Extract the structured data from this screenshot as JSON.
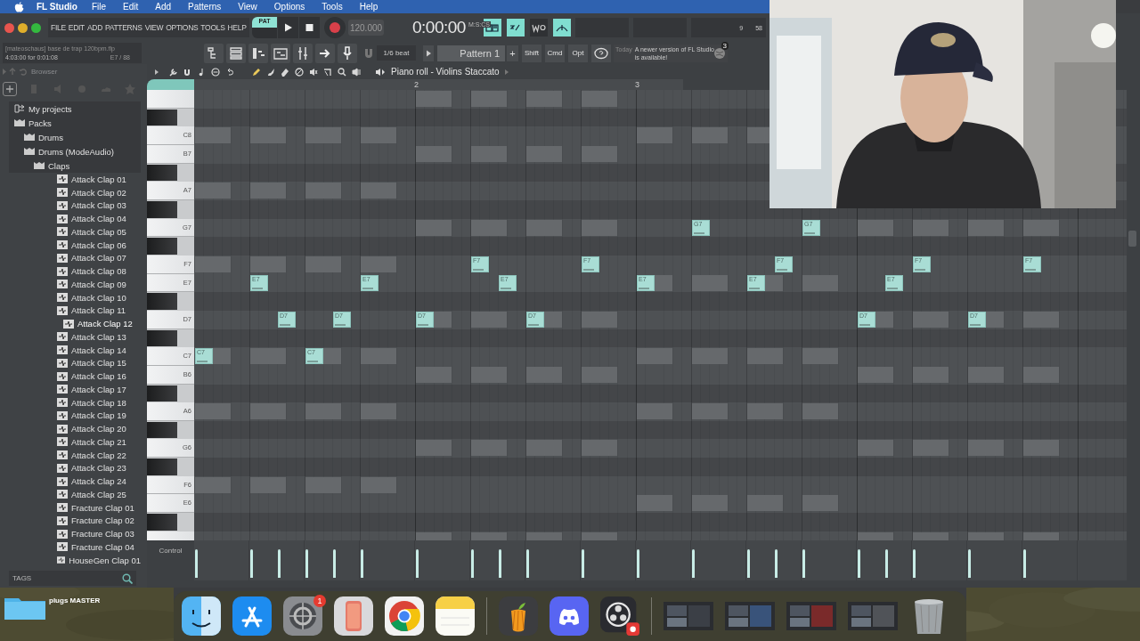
{
  "menubar": {
    "app": "FL Studio",
    "items": [
      "File",
      "Edit",
      "Add",
      "Patterns",
      "View",
      "Options",
      "Tools",
      "Help"
    ]
  },
  "toolbar": {
    "menu": [
      "FILE",
      "EDIT",
      "ADD",
      "PATTERNS",
      "VIEW",
      "OPTIONS",
      "TOOLS",
      "HELP"
    ],
    "pat_label": "PAT",
    "pattern_mode": true,
    "tempo": "120.000",
    "time": "0:00:00",
    "time_unit": "M:S:CS",
    "toggles": [
      {
        "on": true
      },
      {
        "on": true
      },
      {
        "on": false
      },
      {
        "on": true
      }
    ],
    "cpu": "9",
    "memory": "58"
  },
  "project": {
    "title": "[mateoschaus] base de trap 120bpm.flp",
    "time": "4:03:00 for 0:01:08",
    "note": "E7 / 88"
  },
  "snap": "1/6 beat",
  "pattern": "Pattern 1",
  "pattern_add": "+",
  "modifiers": [
    "Shift",
    "Cmd",
    "Opt"
  ],
  "hint": {
    "day": "Today",
    "text": "A newer version of FL Studio is available!",
    "badge": "3"
  },
  "browser": {
    "title": "Browser",
    "tags_label": "TAGS",
    "tree": [
      {
        "label": "My projects",
        "kind": "projects",
        "selected": false
      },
      {
        "label": "Packs",
        "kind": "folder",
        "selected": false,
        "children": [
          {
            "label": "Drums",
            "kind": "folder",
            "selected": false
          },
          {
            "label": "Drums (ModeAudio)",
            "kind": "folder",
            "selected": false,
            "children": [
              {
                "label": "Claps",
                "kind": "folder",
                "selected": false,
                "children": [
                  {
                    "label": "Attack Clap 01",
                    "kind": "sample",
                    "selected": false
                  },
                  {
                    "label": "Attack Clap 02",
                    "kind": "sample",
                    "selected": false
                  },
                  {
                    "label": "Attack Clap 03",
                    "kind": "sample",
                    "selected": false
                  },
                  {
                    "label": "Attack Clap 04",
                    "kind": "sample",
                    "selected": false
                  },
                  {
                    "label": "Attack Clap 05",
                    "kind": "sample",
                    "selected": false
                  },
                  {
                    "label": "Attack Clap 06",
                    "kind": "sample",
                    "selected": false
                  },
                  {
                    "label": "Attack Clap 07",
                    "kind": "sample",
                    "selected": false
                  },
                  {
                    "label": "Attack Clap 08",
                    "kind": "sample",
                    "selected": false
                  },
                  {
                    "label": "Attack Clap 09",
                    "kind": "sample",
                    "selected": false
                  },
                  {
                    "label": "Attack Clap 10",
                    "kind": "sample",
                    "selected": false
                  },
                  {
                    "label": "Attack Clap 11",
                    "kind": "sample",
                    "selected": false
                  },
                  {
                    "label": "Attack Clap 12",
                    "kind": "sample",
                    "selected": true
                  },
                  {
                    "label": "Attack Clap 13",
                    "kind": "sample",
                    "selected": false
                  },
                  {
                    "label": "Attack Clap 14",
                    "kind": "sample",
                    "selected": false
                  },
                  {
                    "label": "Attack Clap 15",
                    "kind": "sample",
                    "selected": false
                  },
                  {
                    "label": "Attack Clap 16",
                    "kind": "sample",
                    "selected": false
                  },
                  {
                    "label": "Attack Clap 17",
                    "kind": "sample",
                    "selected": false
                  },
                  {
                    "label": "Attack Clap 18",
                    "kind": "sample",
                    "selected": false
                  },
                  {
                    "label": "Attack Clap 19",
                    "kind": "sample",
                    "selected": false
                  },
                  {
                    "label": "Attack Clap 20",
                    "kind": "sample",
                    "selected": false
                  },
                  {
                    "label": "Attack Clap 21",
                    "kind": "sample",
                    "selected": false
                  },
                  {
                    "label": "Attack Clap 22",
                    "kind": "sample",
                    "selected": false
                  },
                  {
                    "label": "Attack Clap 23",
                    "kind": "sample",
                    "selected": false
                  },
                  {
                    "label": "Attack Clap 24",
                    "kind": "sample",
                    "selected": false
                  },
                  {
                    "label": "Attack Clap 25",
                    "kind": "sample",
                    "selected": false
                  },
                  {
                    "label": "Fracture Clap 01",
                    "kind": "sample",
                    "selected": false
                  },
                  {
                    "label": "Fracture Clap 02",
                    "kind": "sample",
                    "selected": false
                  },
                  {
                    "label": "Fracture Clap 03",
                    "kind": "sample",
                    "selected": false
                  },
                  {
                    "label": "Fracture Clap 04",
                    "kind": "sample",
                    "selected": false
                  },
                  {
                    "label": "HouseGen Clap 01",
                    "kind": "sample",
                    "selected": false
                  }
                ]
              }
            ]
          }
        ]
      }
    ]
  },
  "piano_roll": {
    "title": "Piano roll - Violins Staccato",
    "control_label": "Control",
    "tools": [
      {
        "kind": "pencil",
        "selected": true
      },
      {
        "kind": "brush",
        "selected": false
      },
      {
        "kind": "delete",
        "selected": false
      },
      {
        "kind": "mute",
        "selected": false
      },
      {
        "kind": "slice",
        "selected": false
      },
      {
        "kind": "select",
        "selected": false
      },
      {
        "kind": "zoom",
        "selected": false
      },
      {
        "kind": "playback",
        "selected": false
      }
    ],
    "bars": [
      {
        "label": "2"
      },
      {
        "label": "3"
      }
    ],
    "rows": [
      {
        "kind": "white",
        "beats": [
          {
            "kind": "rest"
          },
          {
            "kind": "rest"
          },
          {
            "kind": "rest"
          },
          {
            "kind": "rest"
          },
          {
            "kind": "ghost"
          },
          {
            "kind": "ghost"
          },
          {
            "kind": "ghost"
          },
          {
            "kind": "ghost"
          }
        ]
      },
      {
        "kind": "black"
      },
      {
        "kind": "white",
        "label": "C8",
        "beats": [
          {
            "kind": "ghost"
          },
          {
            "kind": "ghost"
          },
          {
            "kind": "ghost"
          },
          {
            "kind": "ghost"
          },
          {
            "kind": "rest"
          },
          {
            "kind": "rest"
          },
          {
            "kind": "rest"
          },
          {
            "kind": "rest"
          },
          {
            "kind": "ghost"
          },
          {
            "kind": "ghost"
          },
          {
            "kind": "ghost"
          }
        ]
      },
      {
        "kind": "white",
        "label": "B7",
        "beats": [
          {
            "kind": "rest"
          },
          {
            "kind": "rest"
          },
          {
            "kind": "rest"
          },
          {
            "kind": "rest"
          },
          {
            "kind": "ghost"
          },
          {
            "kind": "ghost"
          },
          {
            "kind": "ghost"
          },
          {
            "kind": "ghost"
          }
        ]
      },
      {
        "kind": "black"
      },
      {
        "kind": "white",
        "label": "A7",
        "beats": [
          {
            "kind": "ghost"
          },
          {
            "kind": "ghost"
          },
          {
            "kind": "ghost"
          },
          {
            "kind": "ghost"
          }
        ]
      },
      {
        "kind": "black"
      },
      {
        "kind": "white",
        "label": "G7",
        "beats": [
          {
            "kind": "rest"
          },
          {
            "kind": "rest"
          },
          {
            "kind": "rest"
          },
          {
            "kind": "rest"
          },
          {
            "kind": "ghost"
          },
          {
            "kind": "ghost"
          },
          {
            "kind": "ghost"
          },
          {
            "kind": "ghost"
          },
          {
            "kind": "rest"
          },
          {
            "kind": "rest",
            "note": {
              "label": "G7"
            }
          },
          {
            "kind": "rest"
          },
          {
            "kind": "rest",
            "note": {
              "label": "G7"
            }
          },
          {
            "kind": "ghost"
          },
          {
            "kind": "ghost"
          },
          {
            "kind": "ghost"
          },
          {
            "kind": "ghost"
          }
        ]
      },
      {
        "kind": "black"
      },
      {
        "kind": "white",
        "label": "F7",
        "beats": [
          {
            "kind": "ghost"
          },
          {
            "kind": "ghost"
          },
          {
            "kind": "ghost"
          },
          {
            "kind": "ghost"
          },
          {
            "kind": "rest"
          },
          {
            "kind": "rest",
            "note": {
              "label": "F7"
            }
          },
          {
            "kind": "rest"
          },
          {
            "kind": "rest",
            "note": {
              "label": "F7"
            }
          },
          {
            "kind": "rest"
          },
          {
            "kind": "rest"
          },
          {
            "kind": "rest",
            "note_mid": {
              "label": "F7"
            }
          },
          {
            "kind": "rest"
          },
          {
            "kind": "rest"
          },
          {
            "kind": "rest",
            "note": {
              "label": "F7"
            }
          },
          {
            "kind": "rest"
          },
          {
            "kind": "rest",
            "note": {
              "label": "F7"
            }
          }
        ]
      },
      {
        "kind": "white",
        "label": "E7",
        "beats": [
          {
            "kind": "rest"
          },
          {
            "kind": "rest",
            "note": {
              "label": "E7"
            }
          },
          {
            "kind": "rest"
          },
          {
            "kind": "rest",
            "note": {
              "label": "E7"
            }
          },
          {
            "kind": "rest"
          },
          {
            "kind": "rest",
            "note_mid": {
              "label": "E7"
            }
          },
          {
            "kind": "rest"
          },
          {
            "kind": "rest"
          },
          {
            "kind": "ghost",
            "note": {
              "label": "E7"
            }
          },
          {
            "kind": "ghost"
          },
          {
            "kind": "ghost",
            "note": {
              "label": "E7"
            }
          },
          {
            "kind": "ghost"
          },
          {
            "kind": "rest",
            "note_mid": {
              "label": "E7"
            }
          }
        ]
      },
      {
        "kind": "black"
      },
      {
        "kind": "white",
        "label": "D7",
        "beats": [
          {
            "kind": "rest"
          },
          {
            "kind": "rest",
            "note_mid": {
              "label": "D7"
            }
          },
          {
            "kind": "rest",
            "note_mid": {
              "label": "D7"
            }
          },
          {
            "kind": "rest"
          },
          {
            "kind": "ghost",
            "note": {
              "label": "D7"
            }
          },
          {
            "kind": "ghost"
          },
          {
            "kind": "ghost",
            "note": {
              "label": "D7"
            }
          },
          {
            "kind": "ghost"
          },
          {
            "kind": "rest"
          },
          {
            "kind": "rest"
          },
          {
            "kind": "rest"
          },
          {
            "kind": "rest"
          },
          {
            "kind": "ghost",
            "note": {
              "label": "D7"
            }
          },
          {
            "kind": "ghost"
          },
          {
            "kind": "ghost",
            "note": {
              "label": "D7"
            }
          },
          {
            "kind": "ghost"
          }
        ]
      },
      {
        "kind": "black"
      },
      {
        "kind": "white",
        "label": "C7",
        "beats": [
          {
            "kind": "ghost",
            "note": {
              "label": "C7"
            }
          },
          {
            "kind": "ghost"
          },
          {
            "kind": "ghost",
            "note": {
              "label": "C7"
            }
          },
          {
            "kind": "ghost"
          },
          {
            "kind": "rest"
          },
          {
            "kind": "rest"
          },
          {
            "kind": "rest"
          },
          {
            "kind": "rest"
          },
          {
            "kind": "ghost"
          },
          {
            "kind": "ghost"
          },
          {
            "kind": "ghost"
          },
          {
            "kind": "ghost"
          }
        ]
      },
      {
        "kind": "white",
        "label": "B6",
        "beats": [
          {
            "kind": "rest"
          },
          {
            "kind": "rest"
          },
          {
            "kind": "rest"
          },
          {
            "kind": "rest"
          },
          {
            "kind": "ghost"
          },
          {
            "kind": "ghost"
          },
          {
            "kind": "ghost"
          },
          {
            "kind": "ghost"
          },
          {
            "kind": "rest"
          },
          {
            "kind": "rest"
          },
          {
            "kind": "rest"
          },
          {
            "kind": "rest"
          },
          {
            "kind": "ghost"
          },
          {
            "kind": "ghost"
          },
          {
            "kind": "ghost"
          },
          {
            "kind": "ghost"
          }
        ]
      },
      {
        "kind": "black"
      },
      {
        "kind": "white",
        "label": "A6",
        "beats": [
          {
            "kind": "ghost"
          },
          {
            "kind": "ghost"
          },
          {
            "kind": "ghost"
          },
          {
            "kind": "ghost"
          },
          {
            "kind": "rest"
          },
          {
            "kind": "rest"
          },
          {
            "kind": "rest"
          },
          {
            "kind": "rest"
          },
          {
            "kind": "ghost"
          },
          {
            "kind": "ghost"
          },
          {
            "kind": "ghost"
          },
          {
            "kind": "ghost"
          }
        ]
      },
      {
        "kind": "black"
      },
      {
        "kind": "white",
        "label": "G6",
        "beats": [
          {
            "kind": "rest"
          },
          {
            "kind": "rest"
          },
          {
            "kind": "rest"
          },
          {
            "kind": "rest"
          },
          {
            "kind": "ghost"
          },
          {
            "kind": "ghost"
          },
          {
            "kind": "ghost"
          },
          {
            "kind": "ghost"
          },
          {
            "kind": "rest"
          },
          {
            "kind": "rest"
          },
          {
            "kind": "rest"
          },
          {
            "kind": "rest"
          },
          {
            "kind": "ghost"
          },
          {
            "kind": "ghost"
          },
          {
            "kind": "ghost"
          },
          {
            "kind": "ghost"
          }
        ]
      },
      {
        "kind": "black"
      },
      {
        "kind": "white",
        "label": "F6",
        "beats": [
          {
            "kind": "ghost"
          },
          {
            "kind": "ghost"
          },
          {
            "kind": "ghost"
          },
          {
            "kind": "ghost"
          }
        ]
      },
      {
        "kind": "white",
        "label": "E6",
        "beats": [
          {
            "kind": "rest"
          },
          {
            "kind": "rest"
          },
          {
            "kind": "rest"
          },
          {
            "kind": "rest"
          },
          {
            "kind": "rest"
          },
          {
            "kind": "rest"
          },
          {
            "kind": "rest"
          },
          {
            "kind": "rest"
          },
          {
            "kind": "ghost"
          },
          {
            "kind": "ghost"
          },
          {
            "kind": "ghost"
          },
          {
            "kind": "ghost"
          }
        ]
      },
      {
        "kind": "black"
      },
      {
        "kind": "white",
        "beats": [
          {
            "kind": "rest"
          },
          {
            "kind": "rest"
          },
          {
            "kind": "rest"
          },
          {
            "kind": "rest"
          },
          {
            "kind": "ghost"
          },
          {
            "kind": "ghost"
          },
          {
            "kind": "ghost"
          },
          {
            "kind": "ghost"
          },
          {
            "kind": "rest"
          },
          {
            "kind": "rest"
          },
          {
            "kind": "rest"
          },
          {
            "kind": "rest"
          },
          {
            "kind": "ghost"
          },
          {
            "kind": "ghost"
          },
          {
            "kind": "ghost"
          },
          {
            "kind": "ghost"
          }
        ]
      }
    ]
  },
  "desktop": {
    "folder_label": "plugs MASTER"
  },
  "dock": {
    "apps": [
      {
        "kind": "finder"
      },
      {
        "kind": "appstore"
      },
      {
        "kind": "settings",
        "badge": "1"
      },
      {
        "kind": "phone"
      },
      {
        "kind": "chrome"
      },
      {
        "kind": "notes"
      },
      {
        "kind": "divider"
      },
      {
        "kind": "fl"
      },
      {
        "kind": "discord"
      },
      {
        "kind": "obs"
      },
      {
        "kind": "divider"
      },
      {
        "kind": "window"
      },
      {
        "kind": "window"
      },
      {
        "kind": "window"
      },
      {
        "kind": "window"
      },
      {
        "kind": "trash"
      }
    ]
  },
  "webcam": {
    "kind": "picture"
  }
}
